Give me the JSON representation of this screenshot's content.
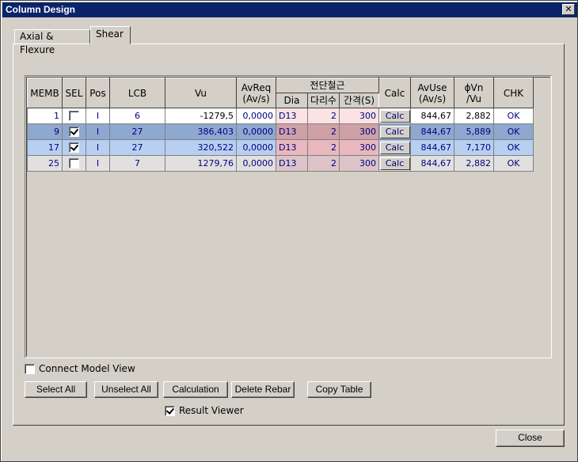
{
  "window": {
    "title": "Column Design",
    "close_glyph": "✕"
  },
  "tabs": [
    {
      "label": "Axial & Flexure"
    },
    {
      "label": "Shear"
    }
  ],
  "table": {
    "headers": {
      "memb": "MEMB",
      "sel": "SEL",
      "pos": "Pos",
      "lcb": "LCB",
      "vu": "Vu",
      "avreq": "AvReq\n(Av/s)",
      "rebar_group": "전단철근",
      "dia": "Dia",
      "legs": "다리수",
      "spacing": "간격(S)",
      "calc": "Calc",
      "avuse": "AvUse\n(Av/s)",
      "phivn": "ϕVn\n/Vu",
      "chk": "CHK"
    },
    "rows": [
      {
        "memb": "1",
        "sel": false,
        "pos": "I",
        "lcb": "6",
        "vu": "-1279,5",
        "avreq": "0,0000",
        "dia": "D13",
        "legs": "2",
        "spacing": "300",
        "calc": "Calc",
        "avuse": "844,67",
        "phivn": "2,882",
        "chk": "OK"
      },
      {
        "memb": "9",
        "sel": true,
        "pos": "I",
        "lcb": "27",
        "vu": "386,403",
        "avreq": "0,0000",
        "dia": "D13",
        "legs": "2",
        "spacing": "300",
        "calc": "Calc",
        "avuse": "844,67",
        "phivn": "5,889",
        "chk": "OK"
      },
      {
        "memb": "17",
        "sel": true,
        "pos": "I",
        "lcb": "27",
        "vu": "320,522",
        "avreq": "0,0000",
        "dia": "D13",
        "legs": "2",
        "spacing": "300",
        "calc": "Calc",
        "avuse": "844,67",
        "phivn": "7,170",
        "chk": "OK"
      },
      {
        "memb": "25",
        "sel": false,
        "pos": "I",
        "lcb": "7",
        "vu": "1279,76",
        "avreq": "0,0000",
        "dia": "D13",
        "legs": "2",
        "spacing": "300",
        "calc": "Calc",
        "avuse": "844,67",
        "phivn": "2,882",
        "chk": "OK"
      }
    ]
  },
  "options": {
    "connect_model_view": "Connect Model View",
    "connect_checked": false,
    "result_viewer": "Result Viewer",
    "result_checked": true
  },
  "buttons": {
    "select_all": "Select All",
    "unselect_all": "Unselect All",
    "calculation": "Calculation",
    "delete_rebar": "Delete Rebar",
    "copy_table": "Copy Table",
    "close": "Close"
  },
  "colors": {
    "row_white": "#ffffff",
    "row_selected_dark": "#8fa8d0",
    "row_selected_light": "#b7cff0",
    "row_grey": "#e2dfdf",
    "rebar_white": "#fbe3e3",
    "rebar_dark": "#cfa0a6",
    "rebar_light": "#e8b8be",
    "rebar_grey": "#dcc4c8"
  }
}
